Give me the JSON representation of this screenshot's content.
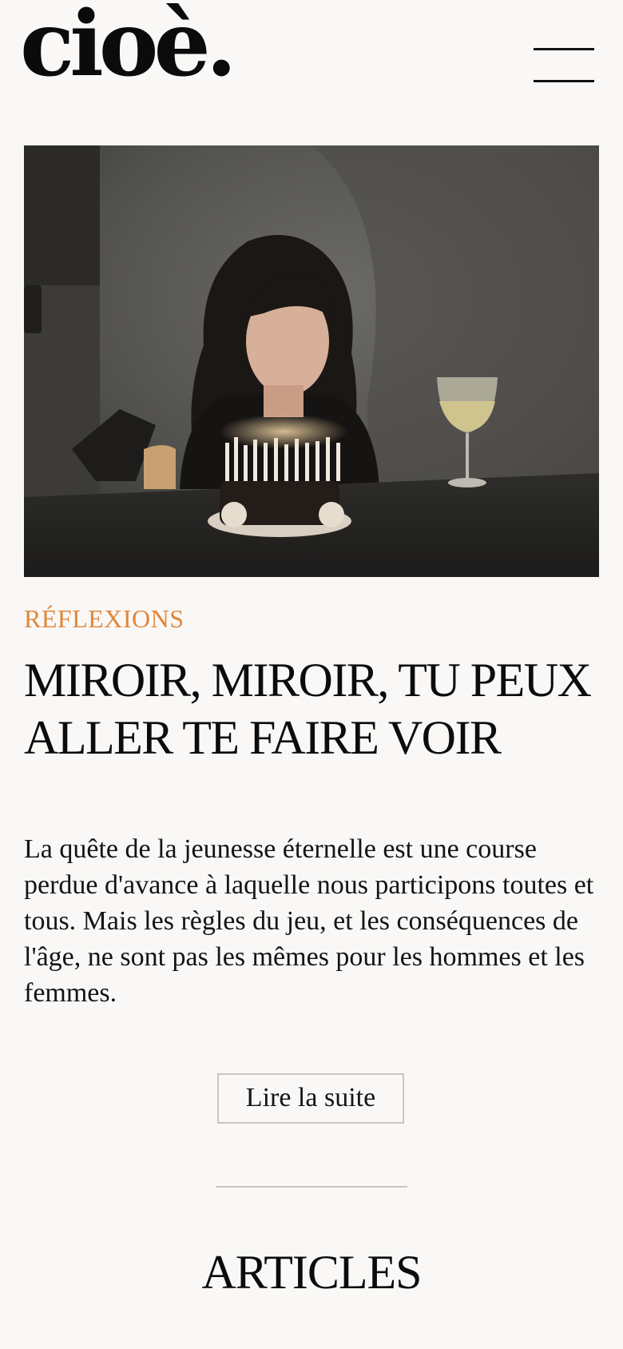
{
  "header": {
    "logo": "cioè.",
    "menu_icon": "hamburger-menu-icon"
  },
  "hero": {
    "image": "photo-woman-blowing-birthday-cake-candles"
  },
  "article": {
    "category": "RÉFLEXIONS",
    "title": "MIROIR, MIROIR, TU PEUX ALLER TE FAIRE VOIR",
    "excerpt": "La quête de la jeunesse éternelle est une course perdue d'avance à laquelle nous participons toutes et tous. Mais les règles du jeu, et les conséquences de l'âge, ne sont pas les mêmes pour les hommes et les femmes.",
    "read_more_label": "Lire la suite"
  },
  "section": {
    "title": "ARTICLES"
  },
  "colors": {
    "background": "#faf8f6",
    "accent": "#e0873a",
    "text": "#111111",
    "border": "#c9c7c5"
  }
}
